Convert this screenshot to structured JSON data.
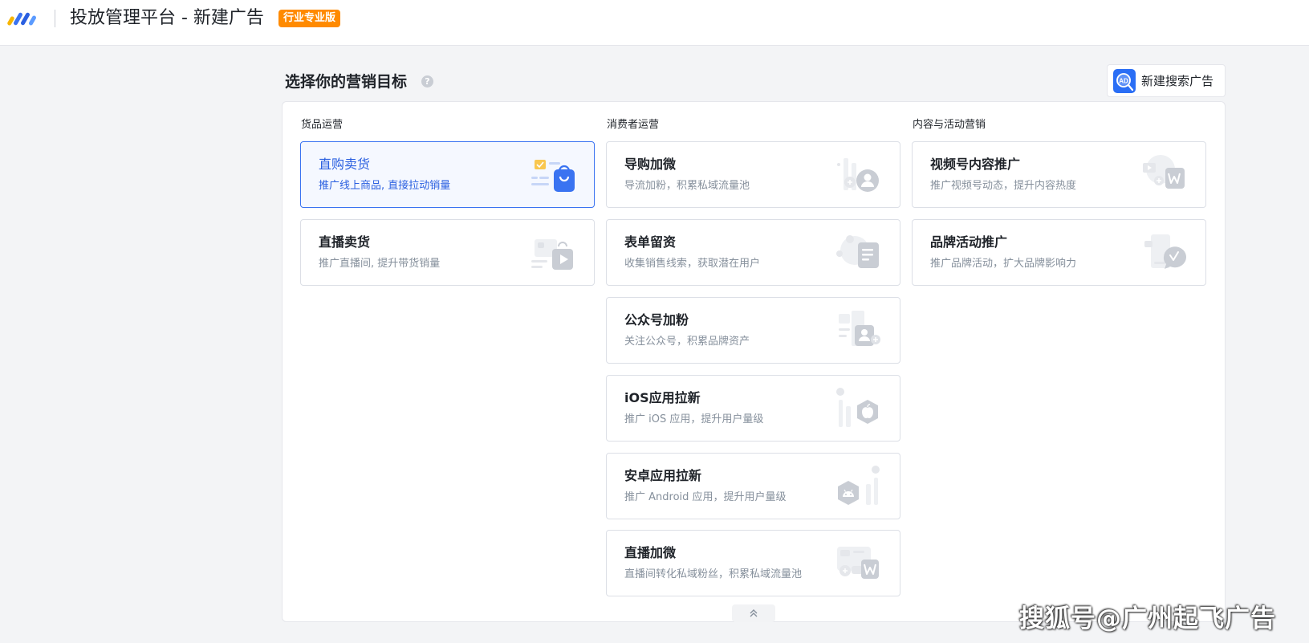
{
  "header": {
    "app_title": "投放管理平台 - 新建广告",
    "edition_badge": "行业专业版"
  },
  "page": {
    "title": "选择你的营销目标",
    "help_glyph": "?",
    "search_ad_button": "新建搜索广告",
    "search_ad_icon_text": "AD"
  },
  "columns": [
    {
      "label": "货品运营",
      "cards": [
        {
          "title": "直购卖货",
          "desc": "推广线上商品, 直接拉动销量",
          "icon": "shopping-bag-icon",
          "selected": true
        },
        {
          "title": "直播卖货",
          "desc": "推广直播间, 提升带货销量",
          "icon": "live-play-icon",
          "selected": false
        }
      ]
    },
    {
      "label": "消费者运营",
      "cards": [
        {
          "title": "导购加微",
          "desc": "导流加粉，积累私域流量池",
          "icon": "add-contact-icon"
        },
        {
          "title": "表单留资",
          "desc": "收集销售线索，获取潜在用户",
          "icon": "form-icon"
        },
        {
          "title": "公众号加粉",
          "desc": "关注公众号，积累品牌资产",
          "icon": "official-account-icon"
        },
        {
          "title": "iOS应用拉新",
          "desc": "推广 iOS 应用，提升用户量级",
          "icon": "apple-icon"
        },
        {
          "title": "安卓应用拉新",
          "desc": "推广 Android 应用，提升用户量级",
          "icon": "android-icon"
        },
        {
          "title": "直播加微",
          "desc": "直播间转化私域粉丝，积累私域流量池",
          "icon": "live-contact-icon"
        }
      ]
    },
    {
      "label": "内容与活动营销",
      "cards": [
        {
          "title": "视频号内容推广",
          "desc": "推广视频号动态，提升内容热度",
          "icon": "channels-icon"
        },
        {
          "title": "品牌活动推广",
          "desc": "推广品牌活动，扩大品牌影响力",
          "icon": "brand-event-icon"
        }
      ]
    }
  ],
  "watermark": "搜狐号@广州起飞广告",
  "colors": {
    "accent": "#3a73f1",
    "badge": "#ff8a00",
    "icon_gray": "#c9cdd4"
  }
}
